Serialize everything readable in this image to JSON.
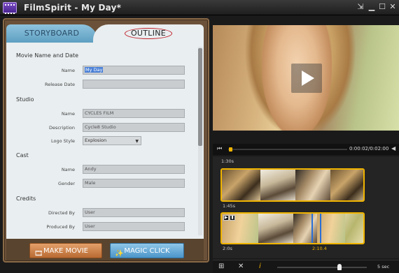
{
  "window": {
    "title": "FilmSpirit - My Day*",
    "controls": [
      "restore-down-arrow-icon",
      "minimize-icon",
      "maximize-icon",
      "close-icon"
    ]
  },
  "tabs": [
    {
      "label": "STORYBOARD",
      "active": false
    },
    {
      "label": "OUTLINE",
      "active": true
    }
  ],
  "form": {
    "sections": {
      "movie": "Movie Name and Date",
      "studio": "Studio",
      "cast": "Cast",
      "credits": "Credits"
    },
    "fields": {
      "name": {
        "label": "Name",
        "value": "My Day"
      },
      "release_date": {
        "label": "Release Date",
        "value": ""
      },
      "studio_name": {
        "label": "Name",
        "value": "CYCLES FILM"
      },
      "description": {
        "label": "Description",
        "value": "Cycle8 Studio"
      },
      "logo_style": {
        "label": "Logo Style",
        "value": "Explosion"
      },
      "cast_name": {
        "label": "Name",
        "value": "Andy"
      },
      "gender": {
        "label": "Gender",
        "value": "Male"
      },
      "directed_by": {
        "label": "Directed By",
        "value": "User"
      },
      "produced_by": {
        "label": "Produced By",
        "value": "User"
      }
    }
  },
  "buttons": {
    "make_movie": "MAKE MOVIE",
    "magic_click": "MAGIC CLICK"
  },
  "player": {
    "time": "0:00:02/0:02:00",
    "progress": 0.02
  },
  "timeline": {
    "labels": {
      "top": "1:30s",
      "mid": "1:45s",
      "bottom_left": "2:0s",
      "bottom_marker": "2:10.4"
    }
  },
  "bottom_toolbar": {
    "zoom_label": "5 sec"
  },
  "colors": {
    "accent_gold": "#f0b400",
    "selection_blue": "#2a6fd6",
    "make_movie": "#c98040",
    "magic_click": "#5ea6d6"
  }
}
